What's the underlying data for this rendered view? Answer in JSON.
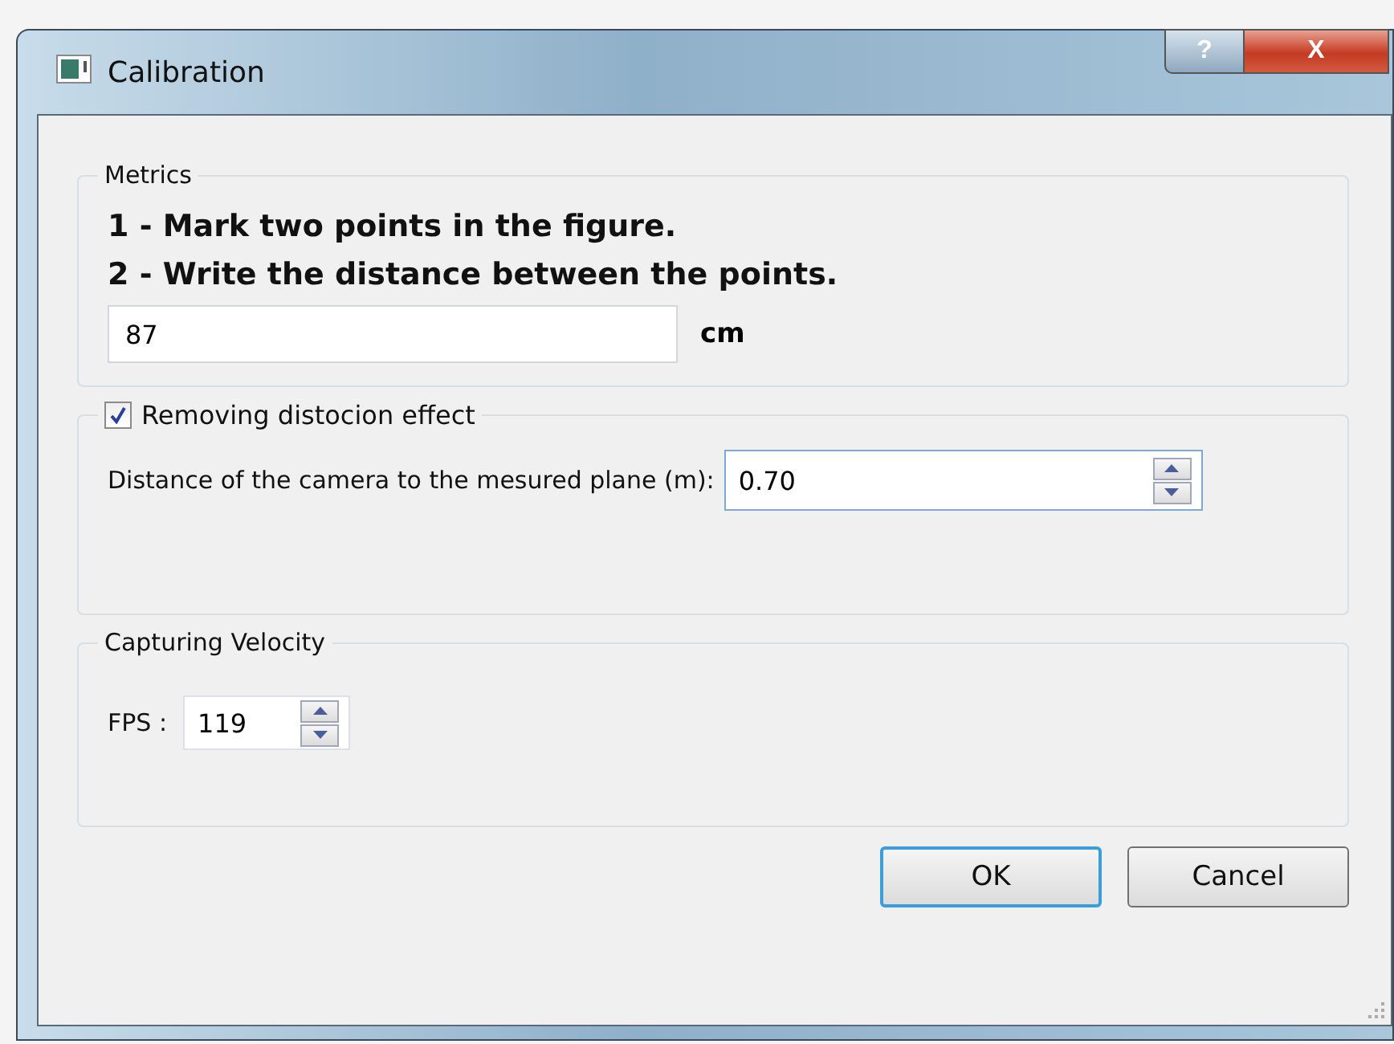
{
  "window": {
    "title": "Calibration",
    "help": "?",
    "close": "X"
  },
  "metrics": {
    "title": "Metrics",
    "steps": [
      "1 - Mark two points in the figure.",
      "2 - Write the distance between the points."
    ],
    "value": "87",
    "unit": "cm"
  },
  "distortion": {
    "title": "Removing distocion effect",
    "checked": true,
    "label": "Distance of the camera to the mesured plane (m):",
    "value": "0.70"
  },
  "velocity": {
    "title": "Capturing Velocity",
    "label": "FPS :",
    "value": "119"
  },
  "buttons": [
    {
      "label": "OK",
      "default": true
    },
    {
      "label": "Cancel",
      "default": false
    }
  ]
}
